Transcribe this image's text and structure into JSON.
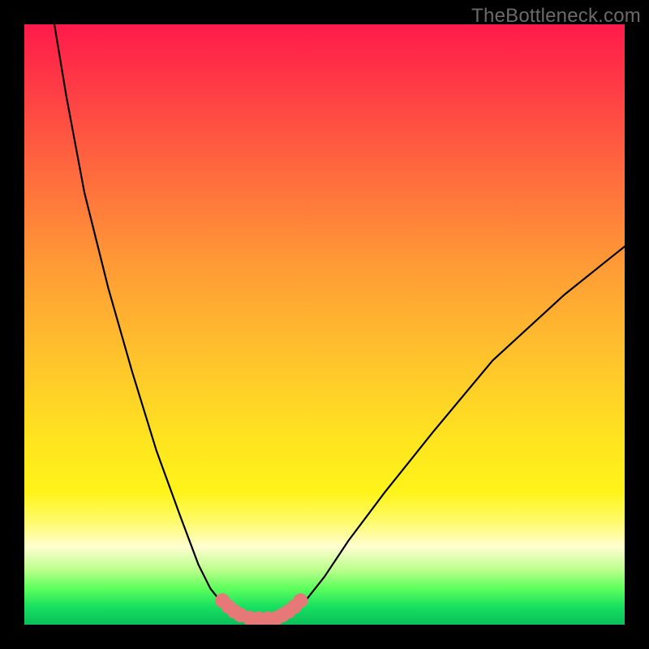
{
  "watermark": "TheBottleneck.com",
  "chart_data": {
    "type": "line",
    "title": "",
    "xlabel": "",
    "ylabel": "",
    "xlim": [
      0,
      100
    ],
    "ylim": [
      0,
      100
    ],
    "series": [
      {
        "name": "left-curve",
        "x": [
          5,
          7,
          10,
          14,
          18,
          22,
          26,
          29,
          31,
          33,
          34.5,
          35.5,
          36.5
        ],
        "y": [
          100,
          88,
          72,
          56,
          42,
          29,
          18,
          10,
          6,
          3.5,
          2.2,
          1.4,
          1.0
        ]
      },
      {
        "name": "right-curve",
        "x": [
          43.5,
          44.5,
          45.5,
          47,
          50,
          54,
          60,
          68,
          78,
          90,
          100
        ],
        "y": [
          1.0,
          1.6,
          2.6,
          4.2,
          8,
          14,
          22,
          32,
          44,
          55,
          63
        ]
      },
      {
        "name": "bottom-markers",
        "x": [
          33.0,
          34.0,
          35.0,
          36.0,
          37.5,
          39.0,
          40.5,
          42.0,
          43.0,
          44.0,
          45.0,
          46.0
        ],
        "y": [
          4.0,
          3.0,
          2.2,
          1.6,
          1.1,
          1.0,
          1.0,
          1.1,
          1.6,
          2.2,
          3.0,
          4.0
        ]
      }
    ],
    "marker_color": "#e77878",
    "line_color": "#000000"
  }
}
